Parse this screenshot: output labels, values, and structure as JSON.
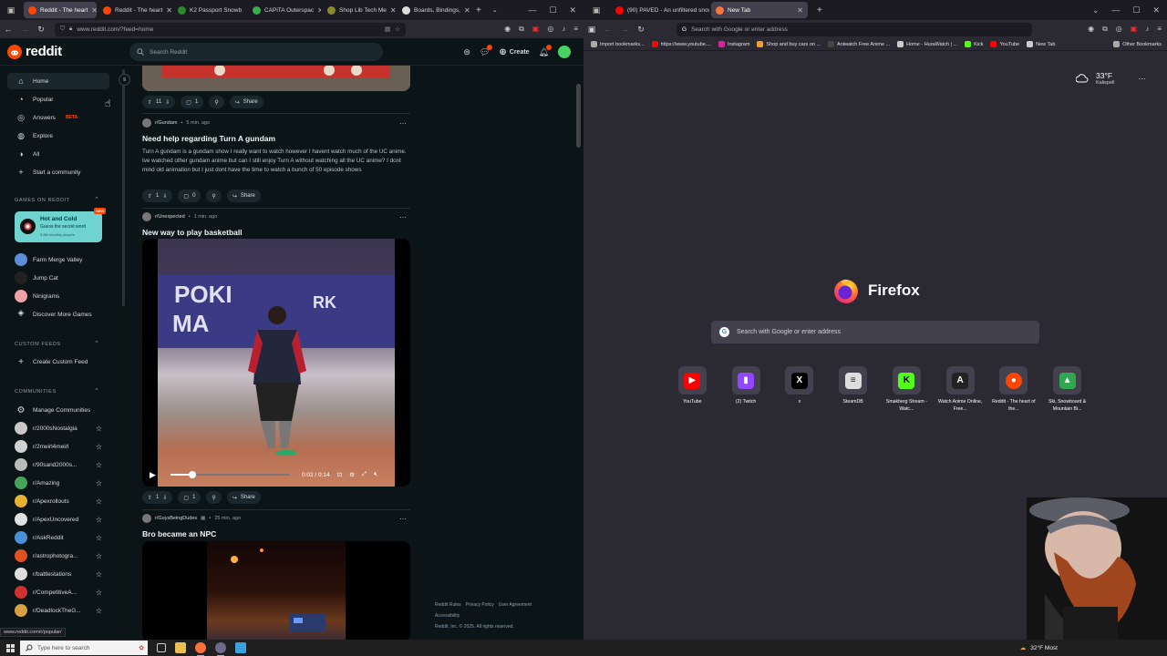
{
  "left_browser": {
    "tabs": [
      {
        "label": "Reddit - The heart",
        "active": true,
        "color": "#ff4500"
      },
      {
        "label": "Reddit - The heart",
        "active": false,
        "color": "#ff4500"
      },
      {
        "label": "K2 Passport Snowb",
        "active": false,
        "color": "#2a8a2a"
      },
      {
        "label": "CAPiTA Outerspac",
        "active": false,
        "color": "#35b04a"
      },
      {
        "label": "Shop Lib Tech Me",
        "active": false,
        "color": "#8a8a2a"
      },
      {
        "label": "Boards, Bindings,",
        "active": false,
        "color": "#dddddd"
      }
    ],
    "url": "www.reddit.com/?feed=home",
    "status_url": "www.reddit.com/r/popular/"
  },
  "reddit": {
    "brand": "reddit",
    "search_placeholder": "Search Reddit",
    "create_label": "Create",
    "nav": [
      {
        "label": "Home",
        "icon": "home-icon"
      },
      {
        "label": "Popular",
        "icon": "popular-icon"
      },
      {
        "label": "Answers",
        "icon": "answers-icon",
        "badge": "BETA"
      },
      {
        "label": "Explore",
        "icon": "explore-icon"
      },
      {
        "label": "All",
        "icon": "all-icon"
      },
      {
        "label": "Start a community",
        "icon": "plus-icon"
      }
    ],
    "games_header": "GAMES ON REDDIT",
    "featured_game": {
      "title": "Hot and Cold",
      "subtitle": "Guess the secret word",
      "players": "3.8M monthly players",
      "badge": "NEW"
    },
    "games": [
      "Farm Merge Valley",
      "Jump Cat",
      "Ninigrams",
      "Discover More Games"
    ],
    "custom_feeds_header": "CUSTOM FEEDS",
    "create_custom_feed": "Create Custom Feed",
    "communities_header": "COMMUNITIES",
    "manage_communities": "Manage Communities",
    "communities": [
      {
        "name": "r/2000sNostalgia",
        "color": "#c8c8c8"
      },
      {
        "name": "r/2meirl4meirl",
        "color": "#d0d0d0"
      },
      {
        "name": "r/90sand2000s...",
        "color": "#bbbbbb"
      },
      {
        "name": "r/Amazing",
        "color": "#46a35a"
      },
      {
        "name": "r/Apexrollouts",
        "color": "#e8b030"
      },
      {
        "name": "r/ApexUncovered",
        "color": "#e0e0e0"
      },
      {
        "name": "r/AskReddit",
        "color": "#4a90d9"
      },
      {
        "name": "r/astrophotogra...",
        "color": "#e05020"
      },
      {
        "name": "r/battlestations",
        "color": "#dddddd"
      },
      {
        "name": "r/CompetitiveA...",
        "color": "#d03030"
      },
      {
        "name": "r/DeadlockTheG...",
        "color": "#d8a040"
      }
    ],
    "posts": [
      {
        "votes": "11",
        "comments": "1",
        "share": "Share"
      },
      {
        "sub": "r/Gundam",
        "time": "5 min. ago",
        "title": "Need help regarding Turn A gundam",
        "body": "Turn A gundam is a gundam show I really want to watch however I havent watch much of the UC anime. Ive watched other gundam anime but can I still enjoy Turn A without watching all the UC anime? I dont mind old animation but I just dont have the time to watch a bunch of 50 episode shows",
        "votes": "1",
        "comments": "0",
        "share": "Share"
      },
      {
        "sub": "r/Unexpected",
        "time": "1 min. ago",
        "title": "New way to play basketball",
        "video_time": "0:02 / 0:14",
        "votes": "1",
        "comments": "1",
        "share": "Share"
      },
      {
        "sub": "r/GuysBeingDudes",
        "time": "25 min. ago",
        "title": "Bro became an NPC"
      }
    ],
    "footer": {
      "links": [
        "Reddit Rules",
        "Privacy Policy",
        "User Agreement",
        "Accessibility"
      ],
      "copyright": "Reddit, Inc. © 2025. All rights reserved."
    }
  },
  "right_browser": {
    "tabs": [
      {
        "label": "(90) PAVED - An unfiltered snow",
        "active": false,
        "color": "#ff0000"
      },
      {
        "label": "New Tab",
        "active": true,
        "color": "#ff7139"
      }
    ],
    "url_placeholder": "Search with Google or enter address",
    "bookmarks": [
      {
        "label": "Import bookmarks...",
        "color": "#aaaaaa"
      },
      {
        "label": "https://www.youtube....",
        "color": "#ff0000"
      },
      {
        "label": "Instagram",
        "color": "#d6249f"
      },
      {
        "label": "Shop and buy cars on ...",
        "color": "#f0a030"
      },
      {
        "label": "Aniwatch Free Anime ...",
        "color": "#444444"
      },
      {
        "label": "Home - HuraWatch | ...",
        "color": "#cccccc"
      },
      {
        "label": "Kick",
        "color": "#53fc18"
      },
      {
        "label": "YouTube",
        "color": "#ff0000"
      },
      {
        "label": "New Tab",
        "color": "#cccccc"
      }
    ],
    "other_bookmarks": "Other Bookmarks",
    "weather": {
      "temp": "33°F",
      "city": "Kalispell"
    },
    "brand": "Firefox",
    "search_placeholder": "Search with Google or enter address",
    "shortcuts": [
      {
        "label": "YouTube",
        "color": "#ff0000",
        "icon": "youtube-icon"
      },
      {
        "label": "(2) Twitch",
        "color": "#9146ff",
        "icon": "twitch-icon"
      },
      {
        "label": "x",
        "color": "#000000",
        "icon": "x-icon"
      },
      {
        "label": "SteamDB",
        "color": "#dddddd",
        "icon": "steamdb-icon"
      },
      {
        "label": "Smakberg Stream - Watc...",
        "color": "#53fc18",
        "icon": "kick-icon"
      },
      {
        "label": "Watch Anime Online, Free...",
        "color": "#222222",
        "icon": "anime-icon"
      },
      {
        "label": "Reddit - The heart of the...",
        "color": "#ff4500",
        "icon": "reddit-icon"
      },
      {
        "label": "Ski, Snowboard & Mountain Bi...",
        "color": "#2fa84f",
        "icon": "evo-icon"
      }
    ]
  },
  "taskbar": {
    "search_placeholder": "Type here to search",
    "weather": "32°F  Most"
  }
}
